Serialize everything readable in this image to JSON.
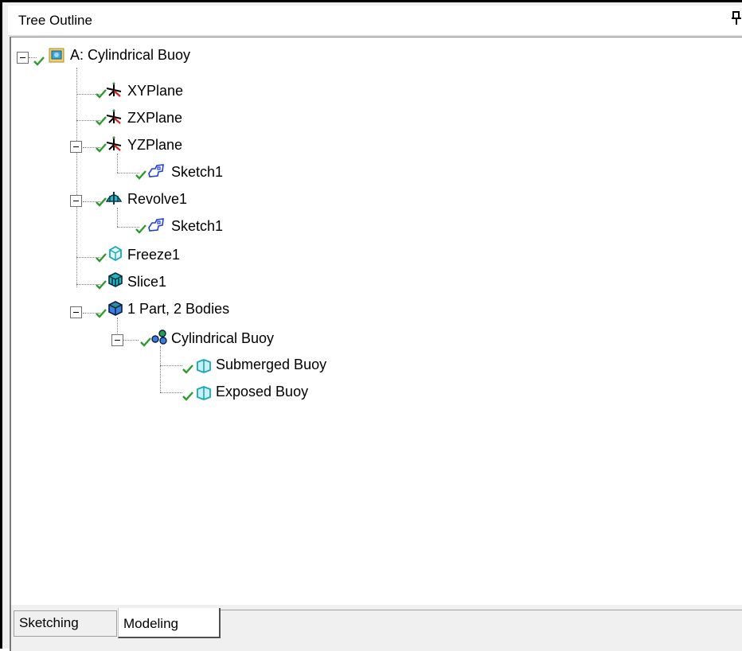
{
  "panel": {
    "title": "Tree Outline"
  },
  "tree": {
    "root": {
      "label": "A: Cylindrical Buoy",
      "icon": "model-icon"
    },
    "items": [
      {
        "label": "XYPlane",
        "icon": "plane-axis-icon"
      },
      {
        "label": "ZXPlane",
        "icon": "plane-axis-icon"
      },
      {
        "label": "YZPlane",
        "icon": "plane-axis-icon"
      },
      {
        "label": "Sketch1",
        "icon": "sketch-icon"
      },
      {
        "label": "Revolve1",
        "icon": "revolve-icon"
      },
      {
        "label": "Sketch1",
        "icon": "sketch-icon"
      },
      {
        "label": "Freeze1",
        "icon": "freeze-icon"
      },
      {
        "label": "Slice1",
        "icon": "slice-icon"
      },
      {
        "label": "1 Part, 2 Bodies",
        "icon": "parts-icon"
      },
      {
        "label": "Cylindrical Buoy",
        "icon": "part-group-icon"
      },
      {
        "label": "Submerged Buoy",
        "icon": "body-icon"
      },
      {
        "label": "Exposed Buoy",
        "icon": "body-icon"
      }
    ]
  },
  "tabs": [
    {
      "label": "Sketching",
      "active": false
    },
    {
      "label": "Modeling",
      "active": true
    }
  ],
  "colors": {
    "check": "#2e9a2e",
    "sketch": "#1e3fd8",
    "body": "#1aa7b5",
    "axis_red": "#d81e1e"
  }
}
